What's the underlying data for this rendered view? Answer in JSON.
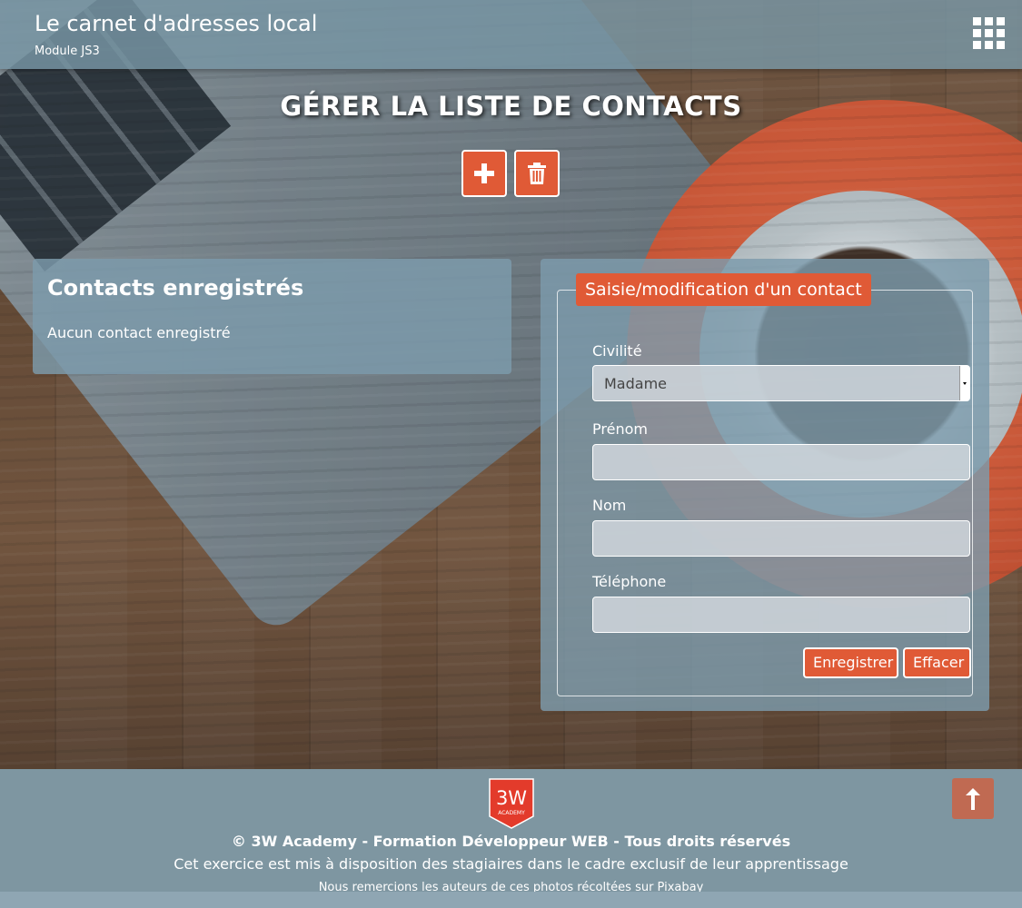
{
  "header": {
    "title": "Le carnet d'adresses local",
    "subtitle": "Module JS3",
    "menu_icon": "apps-grid-icon"
  },
  "main": {
    "page_title": "GÉRER LA LISTE DE CONTACTS",
    "toolbar": {
      "add_icon": "plus-icon",
      "delete_icon": "trash-icon"
    },
    "contacts": {
      "heading": "Contacts enregistrés",
      "empty_text": "Aucun contact enregistré"
    },
    "form": {
      "legend": "Saisie/modification d'un contact",
      "civility_label": "Civilité",
      "civility_value": "Madame",
      "firstname_label": "Prénom",
      "firstname_value": "",
      "lastname_label": "Nom",
      "lastname_value": "",
      "phone_label": "Téléphone",
      "phone_value": "",
      "save_label": "Enregistrer",
      "clear_label": "Effacer"
    }
  },
  "footer": {
    "logo_text_top": "3W",
    "logo_text_bottom": "ACADEMY",
    "copyright": "© 3W Academy - Formation Développeur WEB - Tous droits réservés",
    "notice": "Cet exercice est mis à disposition des stagiaires dans le cadre exclusif de leur apprentissage",
    "credits": "Nous remercions les auteurs de ces photos récoltées sur Pixabay",
    "back_to_top_icon": "arrow-up-icon"
  },
  "colors": {
    "accent": "#e05a36",
    "header_bg": "#7896a5",
    "panel_bg": "#7d9bac"
  }
}
